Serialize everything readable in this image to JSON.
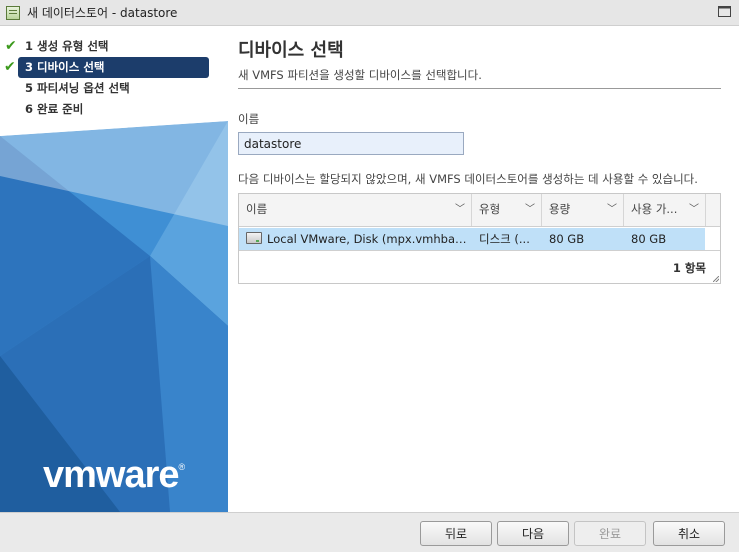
{
  "window": {
    "title": "새 데이터스토어 - datastore"
  },
  "steps": [
    {
      "label": "1 생성 유형 선택",
      "completed": true,
      "active": false
    },
    {
      "label": "3 디바이스 선택",
      "completed": true,
      "active": true
    },
    {
      "label": "5 파티셔닝 옵션 선택",
      "completed": false,
      "active": false
    },
    {
      "label": "6 완료 준비",
      "completed": false,
      "active": false
    }
  ],
  "brand": {
    "logo_text": "vmware",
    "logo_mark": "®"
  },
  "main": {
    "title": "디바이스 선택",
    "subtitle": "새 VMFS 파티션을 생성할 디바이스를 선택합니다.",
    "name_label": "이름",
    "name_value": "datastore",
    "description": "다음 디바이스는 할당되지 않았으며, 새 VMFS 데이터스토어를 생성하는 데 사용할 수 있습니다."
  },
  "table": {
    "columns": [
      "이름",
      "유형",
      "용량",
      "사용 가..."
    ],
    "rows": [
      {
        "name": "Local VMware, Disk (mpx.vmhba0:...",
        "type": "디스크 (...",
        "capacity": "80 GB",
        "available": "80 GB",
        "selected": true
      }
    ],
    "footer_count": "1 항목"
  },
  "buttons": {
    "back": "뒤로",
    "next": "다음",
    "finish": "완료",
    "cancel": "취소"
  },
  "colors": {
    "sidebar_blue": "#2f7fc9",
    "active_step": "#1c3d6b",
    "selected_row": "#bfe0f8",
    "check": "#3c9a1d"
  }
}
